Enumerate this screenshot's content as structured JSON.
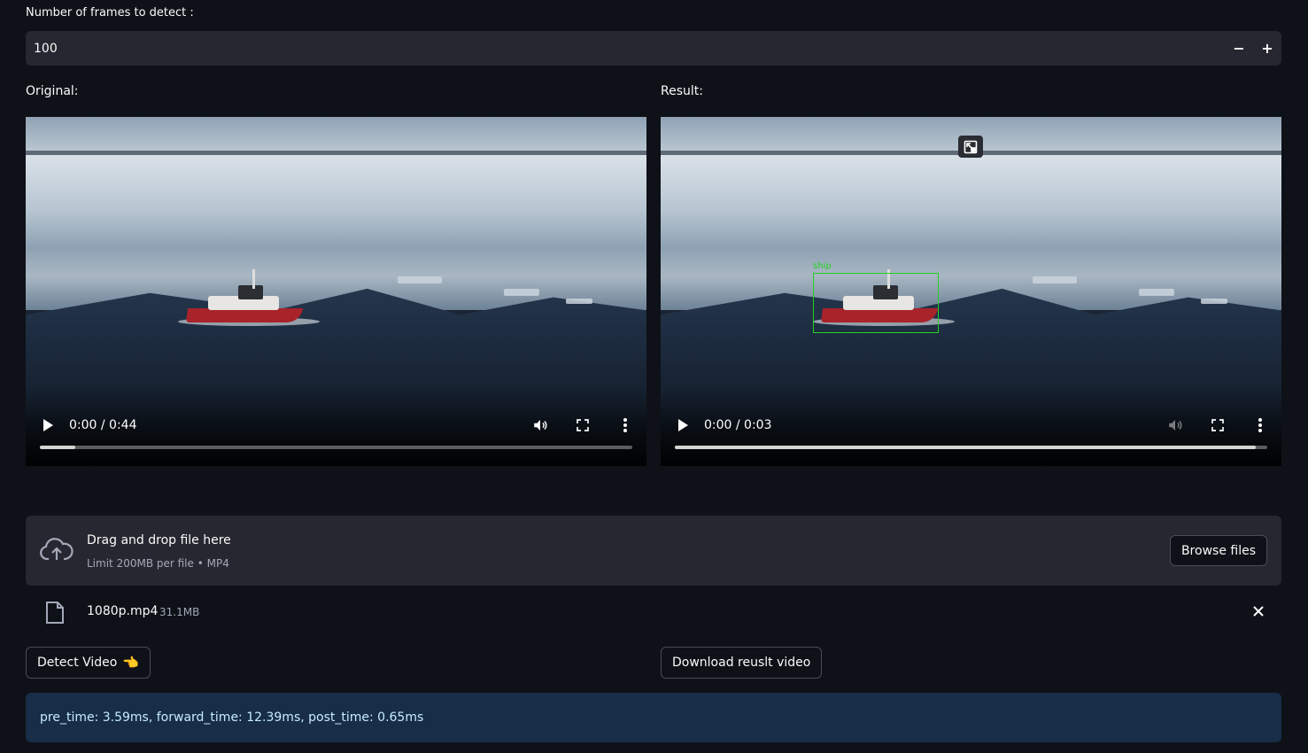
{
  "frames_input": {
    "label": "Number of frames to detect :",
    "value": "100",
    "decrement_label": "−",
    "increment_label": "+"
  },
  "original": {
    "label": "Original:",
    "time": "0:00 / 0:44",
    "progress": 0.06
  },
  "result": {
    "label": "Result:",
    "time": "0:00 / 0:03",
    "progress": 0.98,
    "detection_label": "ship"
  },
  "uploader": {
    "title": "Drag and drop file here",
    "subtitle": "Limit 200MB per file • MP4",
    "browse_label": "Browse files",
    "icon": "cloud-upload-icon"
  },
  "file": {
    "name": "1080p.mp4",
    "size": "31.1MB",
    "icon": "file-icon"
  },
  "buttons": {
    "detect_label": "Detect Video",
    "detect_emoji": "👈",
    "download_label": "Download reuslt video"
  },
  "info": {
    "text": "pre_time: 3.59ms, forward_time: 12.39ms, post_time: 0.65ms"
  },
  "colors": {
    "background": "#0e1117",
    "panel": "#262730",
    "info_bg": "#172d48",
    "info_text": "#c7ebff",
    "detection_box": "#21d321"
  }
}
